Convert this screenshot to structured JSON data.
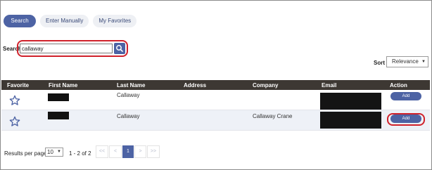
{
  "tabs": [
    {
      "label": "Search",
      "active": true
    },
    {
      "label": "Enter Manually",
      "active": false
    },
    {
      "label": "My Favorites",
      "active": false
    }
  ],
  "search": {
    "label": "Search",
    "value": "callaway",
    "button_icon": "search-icon"
  },
  "sort": {
    "label": "Sort",
    "value": "Relevance"
  },
  "table": {
    "headers": [
      "Favorite",
      "First Name",
      "Last Name",
      "Address",
      "Company",
      "Email",
      "Action"
    ],
    "rows": [
      {
        "favorite": "star-outline",
        "first_name": "",
        "last_name": "Callaway",
        "address": "",
        "company": "",
        "email": "",
        "action": "Add"
      },
      {
        "favorite": "star-outline",
        "first_name": "",
        "last_name": "Callaway",
        "address": "",
        "company": "Callaway Crane",
        "email": "",
        "action": "Add"
      }
    ]
  },
  "pagination": {
    "results_per_page_label": "Results per page",
    "results_per_page": "10",
    "range": "1 - 2 of 2",
    "first": "<<",
    "prev": "<",
    "current": "1",
    "next": ">",
    "last": ">>"
  },
  "colors": {
    "accent": "#4d63a4",
    "header_bg": "#3d3833",
    "highlight": "#d0212b"
  }
}
